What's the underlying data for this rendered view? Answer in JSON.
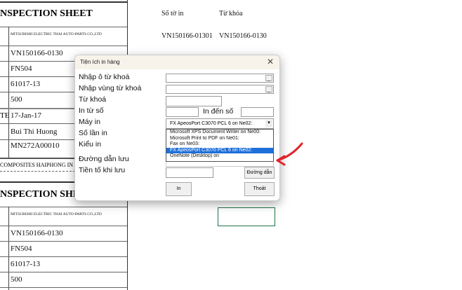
{
  "sheet": {
    "block1": {
      "title": "NSPECTION SHEET",
      "company": "MITSUBISHI ELECTRIC THAI AUTO-PARTS CO.,LTD",
      "rows": [
        "VN150166-0130",
        "FN504",
        "61017-13",
        "500",
        "17-Jan-17",
        "Bui Thi Huong",
        "MN272A00010"
      ],
      "date_label_fragment": "TE"
    },
    "footer": "COMPOSITES HAIPHONG IN",
    "block2": {
      "title": "NSPECTION SHEET",
      "company": "MITSUBISHI ELECTRIC THAI AUTO-PARTS CO.,LTD",
      "rows": [
        "VN150166-0130",
        "FN504",
        "61017-13",
        "500"
      ]
    }
  },
  "right": {
    "col1_header": "Số tờ in",
    "col2_header": "Từ khóa",
    "col1_value": "VN150166-01301",
    "col2_value": "VN150166-0130"
  },
  "dialog": {
    "title": "Tiện ích in hàng",
    "labels": {
      "keyword_cell": "Nhập ô từ khoá",
      "keyword_range": "Nhập vùng từ khoá",
      "keyword": "Từ khoá",
      "from": "In từ số",
      "to": "In đến số",
      "printer": "Máy in",
      "copies": "Số lần in",
      "print_type": "Kiểu in",
      "save_path": "Đường dẫn lưu",
      "prefix": "Tiền tố khi lưu"
    },
    "printer_value": "FX ApeosPort C3070 PCL 6 on Ne02:",
    "printer_options": [
      "Microsoft XPS Document Writer on Ne00:",
      "Microsoft Print to PDF on Ne01:",
      "Fax on Ne03:",
      "FX ApeosPort C3070 PCL 6 on Ne02:",
      "OneNote (Desktop) on"
    ],
    "selected_option": 3,
    "buttons": {
      "browse": "Đường dẫn",
      "print": "In",
      "exit": "Thoát",
      "ref": "_"
    }
  },
  "colors": {
    "accent": "#1e6fd9",
    "arrow": "#e0242b",
    "cell_select": "#217346"
  }
}
